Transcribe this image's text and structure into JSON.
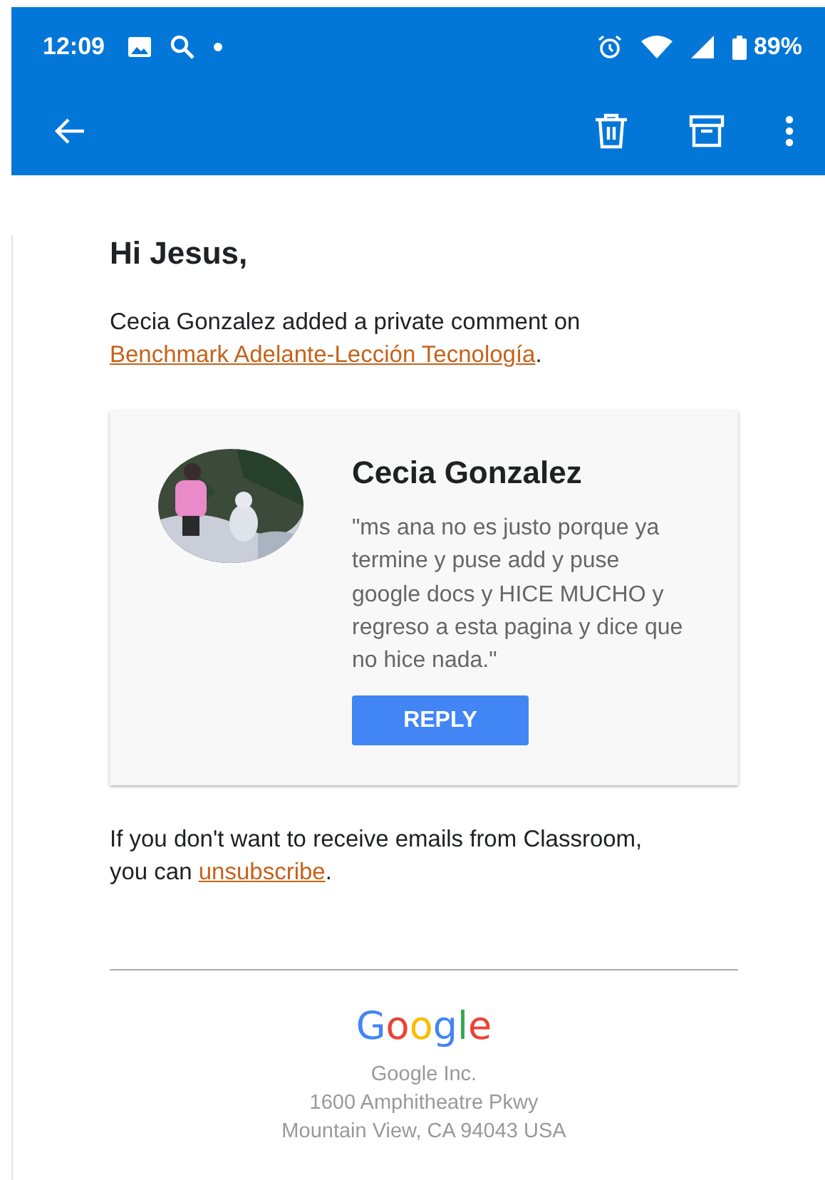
{
  "status_bar": {
    "time": "12:09",
    "battery": "89%"
  },
  "greeting": "Hi Jesus,",
  "intro": {
    "text": "Cecia Gonzalez added a private comment on",
    "link": "Benchmark Adelante-Lección Tecnología",
    "end": "."
  },
  "comment": {
    "author": "Cecia Gonzalez",
    "text": "\"ms ana no es justo porque ya termine y puse add y puse google docs y HICE MUCHO y regreso a esta pagina y dice que no hice nada.\"",
    "button": "REPLY"
  },
  "unsubscribe": {
    "text": "If you don't want to receive emails from Classroom, you can",
    "link": "unsubscribe",
    "end": "."
  },
  "footer": {
    "logo": {
      "text": "Google"
    },
    "address": [
      "Google Inc.",
      "1600 Amphitheatre Pkwy",
      "Mountain View, CA 94043 USA"
    ]
  }
}
